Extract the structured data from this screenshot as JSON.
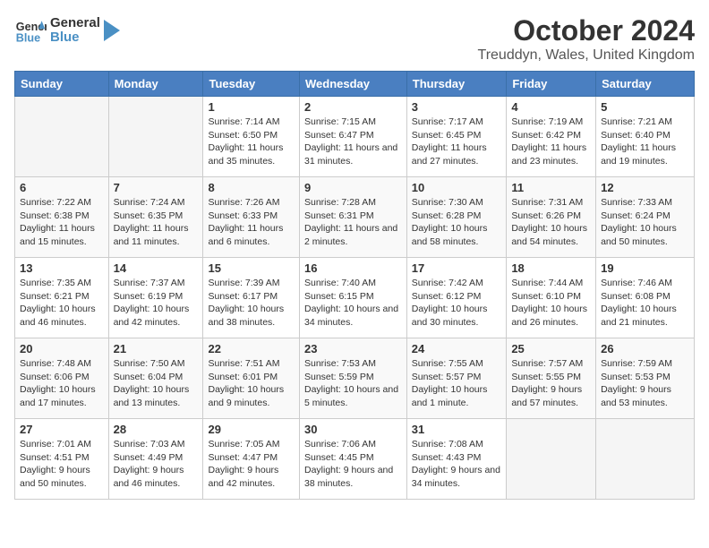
{
  "header": {
    "logo_general": "General",
    "logo_blue": "Blue",
    "month_title": "October 2024",
    "location": "Treuddyn, Wales, United Kingdom"
  },
  "weekdays": [
    "Sunday",
    "Monday",
    "Tuesday",
    "Wednesday",
    "Thursday",
    "Friday",
    "Saturday"
  ],
  "weeks": [
    [
      {
        "day": "",
        "sunrise": "",
        "sunset": "",
        "daylight": ""
      },
      {
        "day": "",
        "sunrise": "",
        "sunset": "",
        "daylight": ""
      },
      {
        "day": "1",
        "sunrise": "Sunrise: 7:14 AM",
        "sunset": "Sunset: 6:50 PM",
        "daylight": "Daylight: 11 hours and 35 minutes."
      },
      {
        "day": "2",
        "sunrise": "Sunrise: 7:15 AM",
        "sunset": "Sunset: 6:47 PM",
        "daylight": "Daylight: 11 hours and 31 minutes."
      },
      {
        "day": "3",
        "sunrise": "Sunrise: 7:17 AM",
        "sunset": "Sunset: 6:45 PM",
        "daylight": "Daylight: 11 hours and 27 minutes."
      },
      {
        "day": "4",
        "sunrise": "Sunrise: 7:19 AM",
        "sunset": "Sunset: 6:42 PM",
        "daylight": "Daylight: 11 hours and 23 minutes."
      },
      {
        "day": "5",
        "sunrise": "Sunrise: 7:21 AM",
        "sunset": "Sunset: 6:40 PM",
        "daylight": "Daylight: 11 hours and 19 minutes."
      }
    ],
    [
      {
        "day": "6",
        "sunrise": "Sunrise: 7:22 AM",
        "sunset": "Sunset: 6:38 PM",
        "daylight": "Daylight: 11 hours and 15 minutes."
      },
      {
        "day": "7",
        "sunrise": "Sunrise: 7:24 AM",
        "sunset": "Sunset: 6:35 PM",
        "daylight": "Daylight: 11 hours and 11 minutes."
      },
      {
        "day": "8",
        "sunrise": "Sunrise: 7:26 AM",
        "sunset": "Sunset: 6:33 PM",
        "daylight": "Daylight: 11 hours and 6 minutes."
      },
      {
        "day": "9",
        "sunrise": "Sunrise: 7:28 AM",
        "sunset": "Sunset: 6:31 PM",
        "daylight": "Daylight: 11 hours and 2 minutes."
      },
      {
        "day": "10",
        "sunrise": "Sunrise: 7:30 AM",
        "sunset": "Sunset: 6:28 PM",
        "daylight": "Daylight: 10 hours and 58 minutes."
      },
      {
        "day": "11",
        "sunrise": "Sunrise: 7:31 AM",
        "sunset": "Sunset: 6:26 PM",
        "daylight": "Daylight: 10 hours and 54 minutes."
      },
      {
        "day": "12",
        "sunrise": "Sunrise: 7:33 AM",
        "sunset": "Sunset: 6:24 PM",
        "daylight": "Daylight: 10 hours and 50 minutes."
      }
    ],
    [
      {
        "day": "13",
        "sunrise": "Sunrise: 7:35 AM",
        "sunset": "Sunset: 6:21 PM",
        "daylight": "Daylight: 10 hours and 46 minutes."
      },
      {
        "day": "14",
        "sunrise": "Sunrise: 7:37 AM",
        "sunset": "Sunset: 6:19 PM",
        "daylight": "Daylight: 10 hours and 42 minutes."
      },
      {
        "day": "15",
        "sunrise": "Sunrise: 7:39 AM",
        "sunset": "Sunset: 6:17 PM",
        "daylight": "Daylight: 10 hours and 38 minutes."
      },
      {
        "day": "16",
        "sunrise": "Sunrise: 7:40 AM",
        "sunset": "Sunset: 6:15 PM",
        "daylight": "Daylight: 10 hours and 34 minutes."
      },
      {
        "day": "17",
        "sunrise": "Sunrise: 7:42 AM",
        "sunset": "Sunset: 6:12 PM",
        "daylight": "Daylight: 10 hours and 30 minutes."
      },
      {
        "day": "18",
        "sunrise": "Sunrise: 7:44 AM",
        "sunset": "Sunset: 6:10 PM",
        "daylight": "Daylight: 10 hours and 26 minutes."
      },
      {
        "day": "19",
        "sunrise": "Sunrise: 7:46 AM",
        "sunset": "Sunset: 6:08 PM",
        "daylight": "Daylight: 10 hours and 21 minutes."
      }
    ],
    [
      {
        "day": "20",
        "sunrise": "Sunrise: 7:48 AM",
        "sunset": "Sunset: 6:06 PM",
        "daylight": "Daylight: 10 hours and 17 minutes."
      },
      {
        "day": "21",
        "sunrise": "Sunrise: 7:50 AM",
        "sunset": "Sunset: 6:04 PM",
        "daylight": "Daylight: 10 hours and 13 minutes."
      },
      {
        "day": "22",
        "sunrise": "Sunrise: 7:51 AM",
        "sunset": "Sunset: 6:01 PM",
        "daylight": "Daylight: 10 hours and 9 minutes."
      },
      {
        "day": "23",
        "sunrise": "Sunrise: 7:53 AM",
        "sunset": "Sunset: 5:59 PM",
        "daylight": "Daylight: 10 hours and 5 minutes."
      },
      {
        "day": "24",
        "sunrise": "Sunrise: 7:55 AM",
        "sunset": "Sunset: 5:57 PM",
        "daylight": "Daylight: 10 hours and 1 minute."
      },
      {
        "day": "25",
        "sunrise": "Sunrise: 7:57 AM",
        "sunset": "Sunset: 5:55 PM",
        "daylight": "Daylight: 9 hours and 57 minutes."
      },
      {
        "day": "26",
        "sunrise": "Sunrise: 7:59 AM",
        "sunset": "Sunset: 5:53 PM",
        "daylight": "Daylight: 9 hours and 53 minutes."
      }
    ],
    [
      {
        "day": "27",
        "sunrise": "Sunrise: 7:01 AM",
        "sunset": "Sunset: 4:51 PM",
        "daylight": "Daylight: 9 hours and 50 minutes."
      },
      {
        "day": "28",
        "sunrise": "Sunrise: 7:03 AM",
        "sunset": "Sunset: 4:49 PM",
        "daylight": "Daylight: 9 hours and 46 minutes."
      },
      {
        "day": "29",
        "sunrise": "Sunrise: 7:05 AM",
        "sunset": "Sunset: 4:47 PM",
        "daylight": "Daylight: 9 hours and 42 minutes."
      },
      {
        "day": "30",
        "sunrise": "Sunrise: 7:06 AM",
        "sunset": "Sunset: 4:45 PM",
        "daylight": "Daylight: 9 hours and 38 minutes."
      },
      {
        "day": "31",
        "sunrise": "Sunrise: 7:08 AM",
        "sunset": "Sunset: 4:43 PM",
        "daylight": "Daylight: 9 hours and 34 minutes."
      },
      {
        "day": "",
        "sunrise": "",
        "sunset": "",
        "daylight": ""
      },
      {
        "day": "",
        "sunrise": "",
        "sunset": "",
        "daylight": ""
      }
    ]
  ]
}
